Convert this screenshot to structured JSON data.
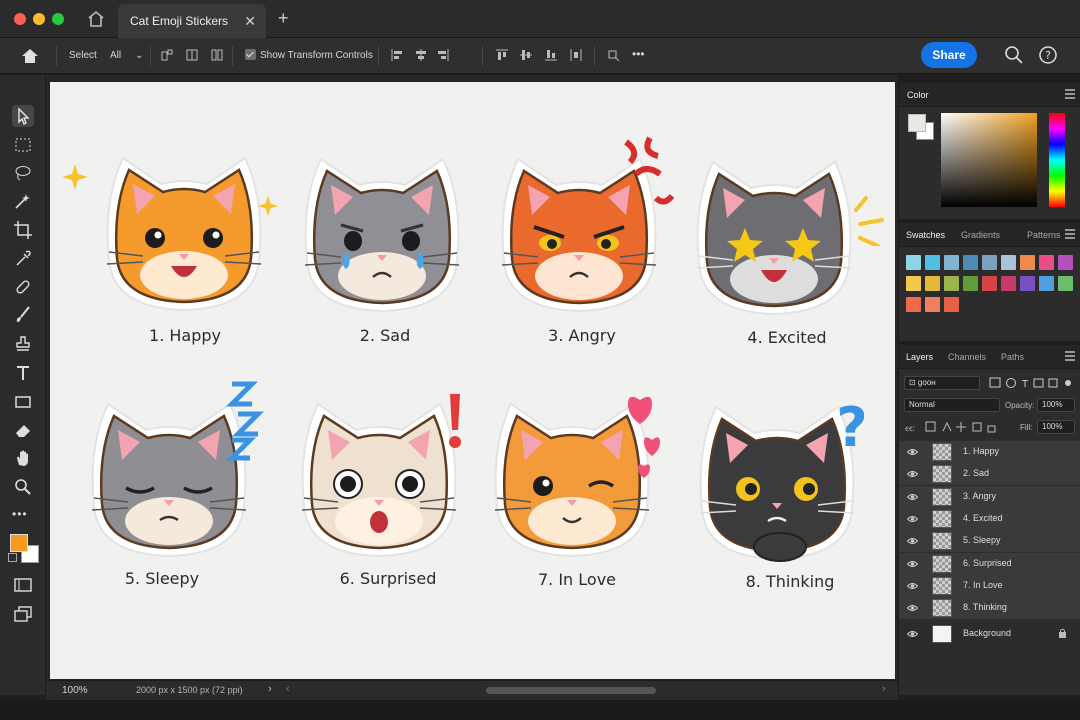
{
  "window": {
    "tab_title": "Cat Emoji Stickers",
    "close_glyph": "✕",
    "new_tab_glyph": "+"
  },
  "options_bar": {
    "select_label": "Select",
    "select_value": "All",
    "show_transform_label": "Show Transform Controls",
    "show_transform_checked": true,
    "share_label": "Share",
    "more_glyph": "•••"
  },
  "toolbar": {
    "more_glyph": "•••",
    "foreground_color": "#f29d22",
    "background_color": "#ffffff"
  },
  "canvas": {
    "stickers": [
      {
        "label": "1. Happy",
        "fur": "#f59a2c",
        "expression": "happy"
      },
      {
        "label": "2. Sad",
        "fur": "#8f8f95",
        "expression": "sad"
      },
      {
        "label": "3. Angry",
        "fur": "#ea6a2e",
        "expression": "angry"
      },
      {
        "label": "4. Excited",
        "fur": "#6d6d72",
        "expression": "excited"
      },
      {
        "label": "5. Sleepy",
        "fur": "#8e8e93",
        "expression": "sleepy"
      },
      {
        "label": "6. Surprised",
        "fur": "#efe1cf",
        "expression": "surprised"
      },
      {
        "label": "7. In Love",
        "fur": "#f39a3a",
        "expression": "in-love"
      },
      {
        "label": "8. Thinking",
        "fur": "#3b3b3e",
        "expression": "thinking"
      }
    ]
  },
  "status_bar": {
    "zoom": "100%",
    "doc_info": "2000 px x 1500 px (72 ppi)",
    "arrow": "›"
  },
  "color_panel": {
    "tab": "Color",
    "foreground": "#e9e9e6",
    "background": "#ffffff",
    "hue": "#f0a020"
  },
  "swatches_panel": {
    "tabs": [
      "Swatches",
      "Gradients",
      "Patterns"
    ],
    "colors": [
      "#8fd4e6",
      "#4fc0e2",
      "#7fb5d0",
      "#4d8bb3",
      "#7aa2bf",
      "#a8c4d6",
      "#f08a4b",
      "#e84f8a",
      "#b54fbf",
      "#f2c94c",
      "#e3b83b",
      "#9bb54a",
      "#5f9e3a",
      "#d64545",
      "#c23b6a",
      "#7a4fbf",
      "#4f9fe0",
      "#6cbd6a",
      "#f06a4a",
      "#f08060",
      "#e85f4a"
    ]
  },
  "layers_panel": {
    "tabs": [
      "Layers",
      "Channels",
      "Paths"
    ],
    "filter_label": "⊡ ɡᴏᴏʜ",
    "blend_mode": "Normal",
    "opacity_label": "Opacity:",
    "opacity_value": "100%",
    "fill_label": "Fill:",
    "fill_value": "100%",
    "lock_label": "ꞓꞓ:",
    "layers": [
      {
        "name": "1. Happy"
      },
      {
        "name": "2. Sad"
      },
      {
        "name": "3. Angry"
      },
      {
        "name": "4. Excited"
      },
      {
        "name": "5. Sleepy"
      },
      {
        "name": "6. Surprised"
      },
      {
        "name": "7. In Love"
      },
      {
        "name": "8. Thinking"
      }
    ],
    "background_layer": "Background"
  }
}
